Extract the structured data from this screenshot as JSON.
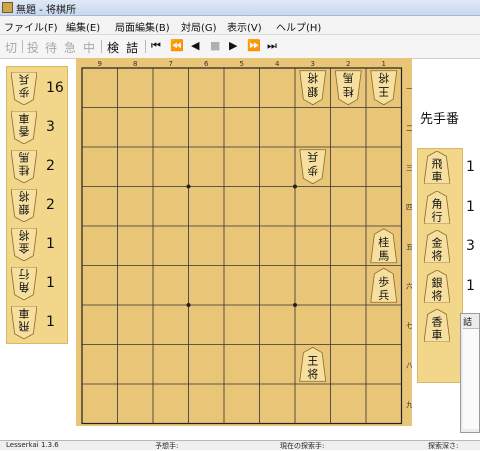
{
  "window": {
    "title": "無題 - 将棋所"
  },
  "menu": [
    "ファイル(F)",
    "編集(E)",
    "局面編集(B)",
    "対局(G)",
    "表示(V)",
    "ヘルプ(H)"
  ],
  "toolbar": {
    "labels": [
      "切",
      "投",
      "待",
      "急",
      "中",
      "検",
      "詰"
    ],
    "nav": [
      "⏮",
      "⏪",
      "◀",
      "■",
      "▶",
      "⏩",
      "⏭"
    ]
  },
  "board": {
    "files": [
      "9",
      "8",
      "7",
      "6",
      "5",
      "4",
      "3",
      "2",
      "1"
    ],
    "ranks": [
      "一",
      "二",
      "三",
      "四",
      "五",
      "六",
      "七",
      "八",
      "九"
    ],
    "pieces": [
      {
        "file": 1,
        "rank": 1,
        "top": "王",
        "bottom": "将",
        "inverted": true
      },
      {
        "file": 2,
        "rank": 1,
        "top": "桂",
        "bottom": "馬",
        "inverted": true
      },
      {
        "file": 3,
        "rank": 1,
        "top": "銀",
        "bottom": "将",
        "inverted": true
      },
      {
        "file": 3,
        "rank": 3,
        "top": "歩",
        "bottom": "兵",
        "inverted": true
      },
      {
        "file": 1,
        "rank": 5,
        "top": "桂",
        "bottom": "馬",
        "inverted": false
      },
      {
        "file": 1,
        "rank": 6,
        "top": "歩",
        "bottom": "兵",
        "inverted": false
      },
      {
        "file": 3,
        "rank": 8,
        "top": "王",
        "bottom": "将",
        "inverted": false
      }
    ]
  },
  "gote_hand": [
    {
      "top": "歩",
      "bottom": "兵",
      "count": "16"
    },
    {
      "top": "香",
      "bottom": "車",
      "count": "3"
    },
    {
      "top": "桂",
      "bottom": "馬",
      "count": "2"
    },
    {
      "top": "銀",
      "bottom": "将",
      "count": "2"
    },
    {
      "top": "金",
      "bottom": "将",
      "count": "1"
    },
    {
      "top": "角",
      "bottom": "行",
      "count": "1"
    },
    {
      "top": "飛",
      "bottom": "車",
      "count": "1"
    }
  ],
  "sente_label": "先手番",
  "sente_hand": [
    {
      "top": "飛",
      "bottom": "車",
      "count": "1"
    },
    {
      "top": "角",
      "bottom": "行",
      "count": "1"
    },
    {
      "top": "金",
      "bottom": "将",
      "count": "3"
    },
    {
      "top": "銀",
      "bottom": "将",
      "count": "1"
    },
    {
      "top": "香",
      "bottom": "車",
      "count": ""
    }
  ],
  "notation_panel": {
    "title": "詰将"
  },
  "statusbar": [
    "Lesserkai 1.3.6",
    "予想手:",
    "現在の探索手:",
    "探索深さ:"
  ],
  "colors": {
    "board": "#e9c578",
    "stand": "#f2d68a",
    "piece": "#f6df9f",
    "grid": "#222222"
  }
}
